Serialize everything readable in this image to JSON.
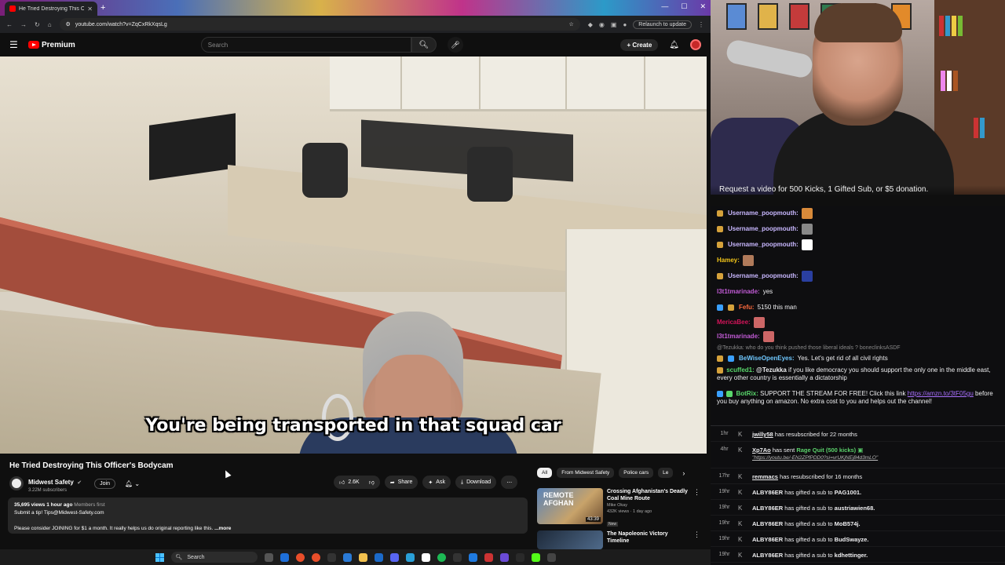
{
  "browser": {
    "tab_title": "He Tried Destroying This O",
    "url": "youtube.com/watch?v=ZqCxRkXqsLg",
    "relaunch_label": "Relaunch to update"
  },
  "youtube": {
    "logo_text": "Premium",
    "search_placeholder": "Search",
    "create_label": "Create"
  },
  "video": {
    "caption": "You're being transported in that squad car",
    "title": "He Tried Destroying This Officer's Bodycam",
    "channel_name": "Midwest Safety",
    "subscribers": "3.22M subscribers",
    "join_label": "Join",
    "likes": "2.6K",
    "share_label": "Share",
    "ask_label": "Ask",
    "download_label": "Download",
    "description": {
      "meta": "35,695 views  1 hour ago",
      "members": "Members first",
      "line1": "Submit a tip! Tips@Midwest-Safety.com",
      "line2": "Please consider JOINING for $1 a month. It really helps us do original reporting like this.",
      "more": "...more"
    }
  },
  "filters": [
    "All",
    "From Midwest Safety",
    "Police cars",
    "Le"
  ],
  "recommendations": [
    {
      "thumb_text": "REMOTE AFGHAN",
      "duration": "43:39",
      "title": "Crossing Afghanistan's Deadly Coal Mine Route",
      "channel": "Mike Okay",
      "stats": "432K views · 1 day ago",
      "badge": "New"
    },
    {
      "thumb_text": "",
      "duration": "",
      "title": "The Napoleonic Victory Timeline",
      "channel": "",
      "stats": "",
      "badge": ""
    }
  ],
  "stream": {
    "request_banner": "Request a video for 500 Kicks, 1 Gifted Sub, or $5 donation."
  },
  "chat": {
    "lines": [
      {
        "user": "Username_poopmouth:",
        "text": "",
        "color": "#c9b8ff"
      },
      {
        "user": "Username_poopmouth:",
        "text": "",
        "color": "#c9b8ff"
      },
      {
        "user": "Username_poopmouth:",
        "text": "",
        "color": "#c9b8ff"
      },
      {
        "user": "Hamey:",
        "text": "",
        "color": "#f0c419"
      },
      {
        "user": "Username_poopmouth:",
        "text": "",
        "color": "#c9b8ff"
      },
      {
        "user": "l3t1tmarinade:",
        "text": "yes",
        "color": "#c25bd6"
      },
      {
        "user": "Fefu:",
        "text": "5150 this man",
        "color": "#ff6a3d"
      },
      {
        "user": "MericaBee:",
        "text": "",
        "color": "#d4145a"
      },
      {
        "user": "l3t1tmarinade:",
        "text": "",
        "color": "#c25bd6"
      }
    ],
    "reply_context": "@Tezukka: who do you think pushed those liberal ideals ? boneclinksASDF",
    "line_bewise": {
      "user": "BeWiseOpenEyes:",
      "text": "Yes. Let's get rid of all civil rights",
      "color": "#6fc8ff"
    },
    "line_scuffed": {
      "user": "scuffed1:",
      "mention": "@Tezukka",
      "text": "if you like democracy you should support the only one in the middle east, every other country is essentially a dictatorship",
      "color": "#59d66b"
    },
    "line_botrix": {
      "user": "BotRix:",
      "text": "SUPPORT THE STREAM FOR FREE! Click this link",
      "link": "https://amzn.to/3tF05gu",
      "text2": "before you buy anything on amazon. No extra cost to you and helps out the channel!",
      "color": "#59d66b"
    }
  },
  "events": [
    {
      "time": "1hr",
      "user": "jwilly58",
      "text": "has resubscribed for 22 months"
    },
    {
      "time": "4hr",
      "user": "Xp7Ao",
      "text": "has sent",
      "amount": "Rage Quit (500 kicks)",
      "quote": "\"https://youtu.be/-EN2ZPfPDD0?si=vrUKjNEj84d3mLO\""
    },
    {
      "time": "17hr",
      "user": "remmacs",
      "text": "has resubscribed for 16 months"
    },
    {
      "time": "19hr",
      "user": "ALBY86ER",
      "text": "has gifted a sub to",
      "target": "PAG1001."
    },
    {
      "time": "19hr",
      "user": "ALBY86ER",
      "text": "has gifted a sub to",
      "target": "austriawien68."
    },
    {
      "time": "19hr",
      "user": "ALBY86ER",
      "text": "has gifted a sub to",
      "target": "MoB574j."
    },
    {
      "time": "19hr",
      "user": "ALBY86ER",
      "text": "has gifted a sub to",
      "target": "BudSwayze."
    },
    {
      "time": "19hr",
      "user": "ALBY86ER",
      "text": "has gifted a sub to",
      "target": "kdhettinger."
    }
  ],
  "taskbar": {
    "search_label": "Search"
  }
}
